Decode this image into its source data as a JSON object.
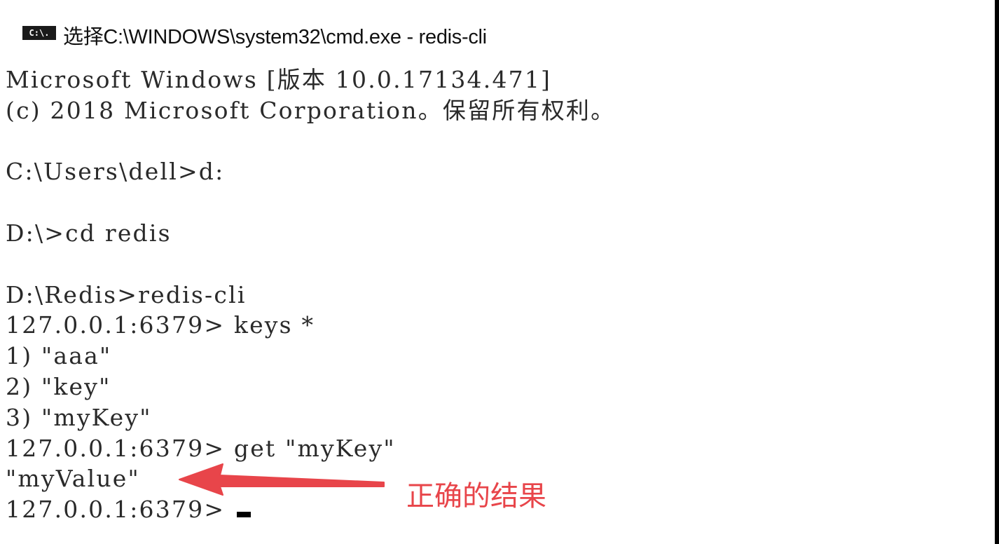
{
  "window": {
    "icon_text": "C:\\.",
    "title": "选择C:\\WINDOWS\\system32\\cmd.exe - redis-cli"
  },
  "console": {
    "lines": [
      "Microsoft Windows [版本 10.0.17134.471]",
      "(c) 2018 Microsoft Corporation。保留所有权利。",
      "",
      "C:\\Users\\dell>d:",
      "",
      "D:\\>cd redis",
      "",
      "D:\\Redis>redis-cli",
      "127.0.0.1:6379> keys *",
      "1) \"aaa\"",
      "2) \"key\"",
      "3) \"myKey\"",
      "127.0.0.1:6379> get \"myKey\"",
      "\"myValue\"",
      "127.0.0.1:6379> "
    ]
  },
  "annotation": {
    "label": "正确的结果",
    "color": "#e8454a"
  },
  "colors": {
    "background": "#ffffff",
    "text": "#2a2a2a",
    "annotation": "#e8454a"
  }
}
